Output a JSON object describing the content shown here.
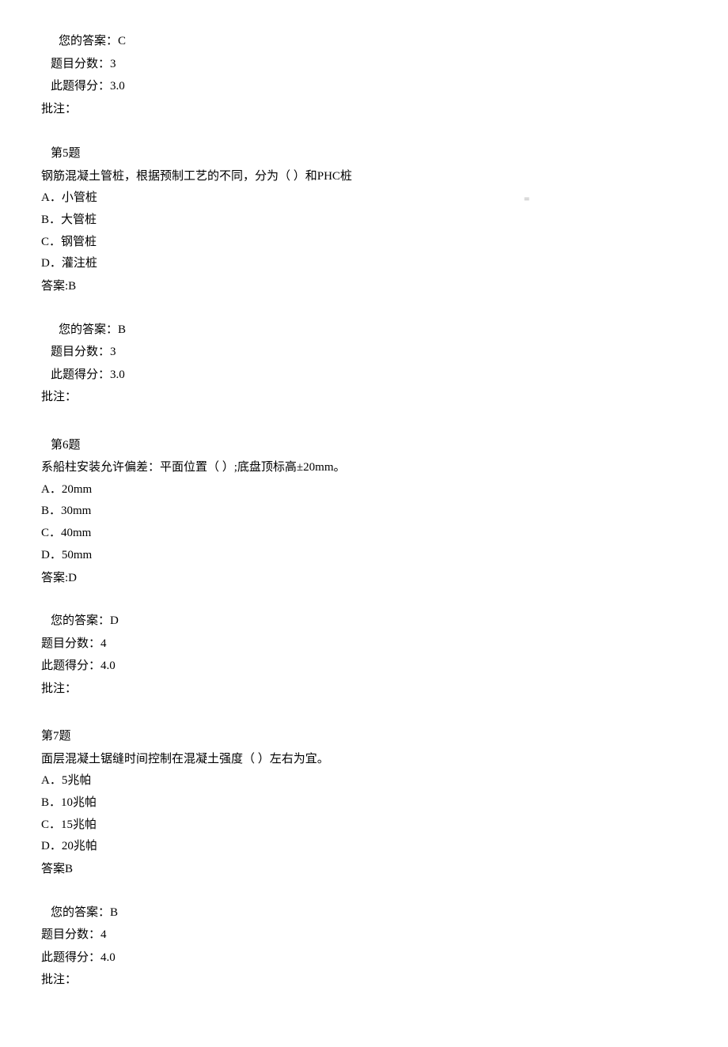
{
  "prevEnd": {
    "yourAnswer": "您的答案：C",
    "qScore": "题目分数：3",
    "gotScore": "此题得分：3.0",
    "remark": "批注："
  },
  "q5": {
    "header": "第5题",
    "stem": "钢筋混凝土管桩，根据预制工艺的不同，分为（ ）和PHC桩",
    "optA": "A．小管桩",
    "optB": "B．大管桩",
    "optC": "C．钢管桩",
    "optD": "D．灌注桩",
    "answerKey": "答案:B",
    "yourAnswer": "您的答案：B",
    "qScore": "题目分数：3",
    "gotScore": "此题得分：3.0",
    "remark": "批注：",
    "marker": "="
  },
  "q6": {
    "header": "第6题",
    "stem": "系船柱安装允许偏差：平面位置（ ）;底盘顶标高±20mm。",
    "optA": "A．20mm",
    "optB": "B．30mm",
    "optC": "C．40mm",
    "optD": "D．50mm",
    "answerKey": "答案:D",
    "yourAnswer": "您的答案：D",
    "qScore": "题目分数：4",
    "gotScore": "此题得分：4.0",
    "remark": "批注："
  },
  "q7": {
    "header": "第7题",
    "stem": "面层混凝土锯缝时间控制在混凝土强度（ ）左右为宜。",
    "optA": "A．5兆帕",
    "optB": "B．10兆帕",
    "optC": "C．15兆帕",
    "optD": "D．20兆帕",
    "answerKey": "答案B",
    "yourAnswer": "您的答案：B",
    "qScore": "题目分数：4",
    "gotScore": "此题得分：4.0",
    "remark": "批注："
  }
}
